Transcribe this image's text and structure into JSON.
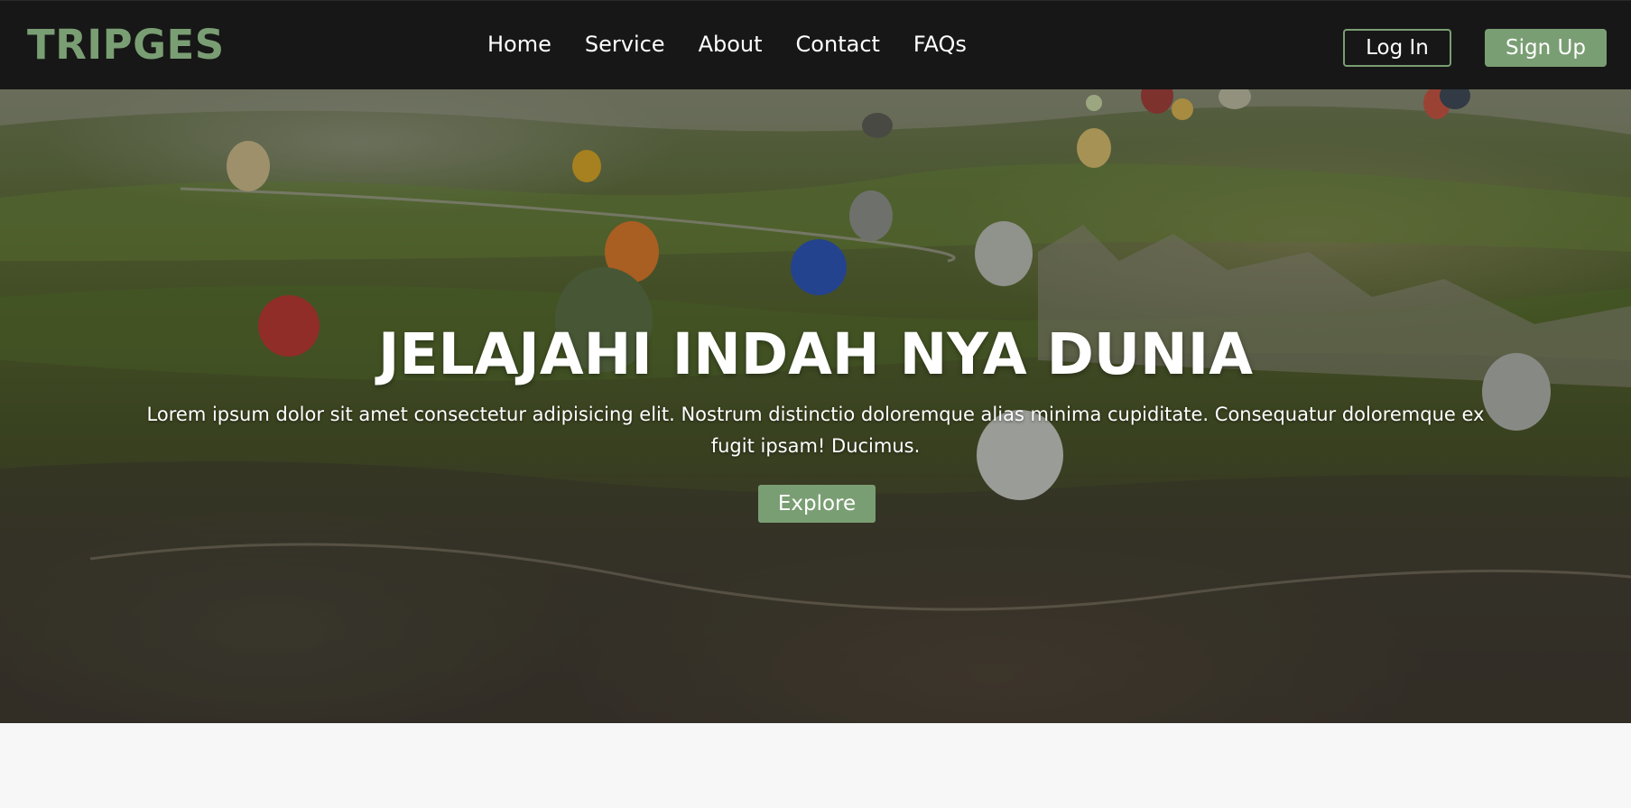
{
  "brand": {
    "logo": "TRIPGES",
    "accent": "#7a9e73"
  },
  "nav": {
    "links": [
      "Home",
      "Service",
      "About",
      "Contact",
      "FAQs"
    ]
  },
  "auth": {
    "login_label": "Log In",
    "signup_label": "Sign Up"
  },
  "hero": {
    "title": "JELAJAHI INDAH NYA DUNIA",
    "description": "Lorem ipsum dolor sit amet consectetur adipisicing elit. Nostrum distinctio doloremque alias minima cupiditate. Consequatur doloremque ex fugit ipsam! Ducimus.",
    "cta_label": "Explore",
    "background_image": "hot air balloons over valley landscape"
  },
  "colors": {
    "navbar_bg": "#171717",
    "page_bg": "#f7f7f7",
    "text": "#ffffff"
  }
}
